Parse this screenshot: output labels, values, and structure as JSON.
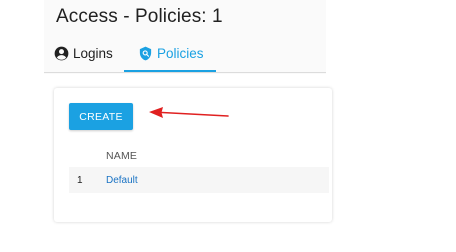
{
  "page": {
    "title": "Access - Policies: 1"
  },
  "tabs": [
    {
      "label": "Logins",
      "icon": "account-circle-icon",
      "active": false
    },
    {
      "label": "Policies",
      "icon": "shield-icon",
      "active": true
    }
  ],
  "toolbar": {
    "create_label": "CREATE"
  },
  "table": {
    "columns": [
      "",
      "NAME"
    ],
    "rows": [
      {
        "num": "1",
        "name": "Default"
      }
    ]
  },
  "colors": {
    "accent": "#1ba1e2",
    "link": "#1a73c4",
    "arrow": "#e02020"
  }
}
